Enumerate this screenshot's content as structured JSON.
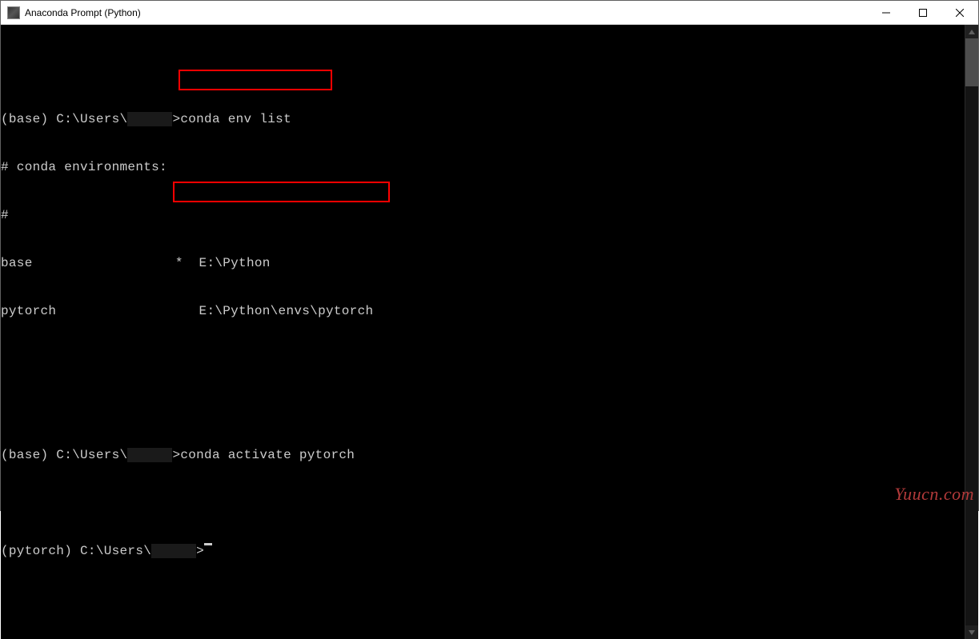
{
  "window": {
    "title": "Anaconda Prompt (Python)"
  },
  "terminal": {
    "line1_prefix": "(base) C:\\Users\\",
    "line1_gt": ">",
    "cmd1": "conda env list",
    "comment1": "# conda environments:",
    "comment2": "#",
    "env_base_name": "base",
    "env_base_mark": "*  E:\\Python",
    "env_pytorch_name": "pytorch",
    "env_pytorch_path": "E:\\Python\\envs\\pytorch",
    "line2_prefix": "(base) C:\\Users\\",
    "cmd2_gt": ">",
    "cmd2": "conda activate pytorch",
    "line3_prefix": "(pytorch) C:\\Users\\",
    "line3_gt": ">"
  },
  "watermark": "Yuucn.com"
}
